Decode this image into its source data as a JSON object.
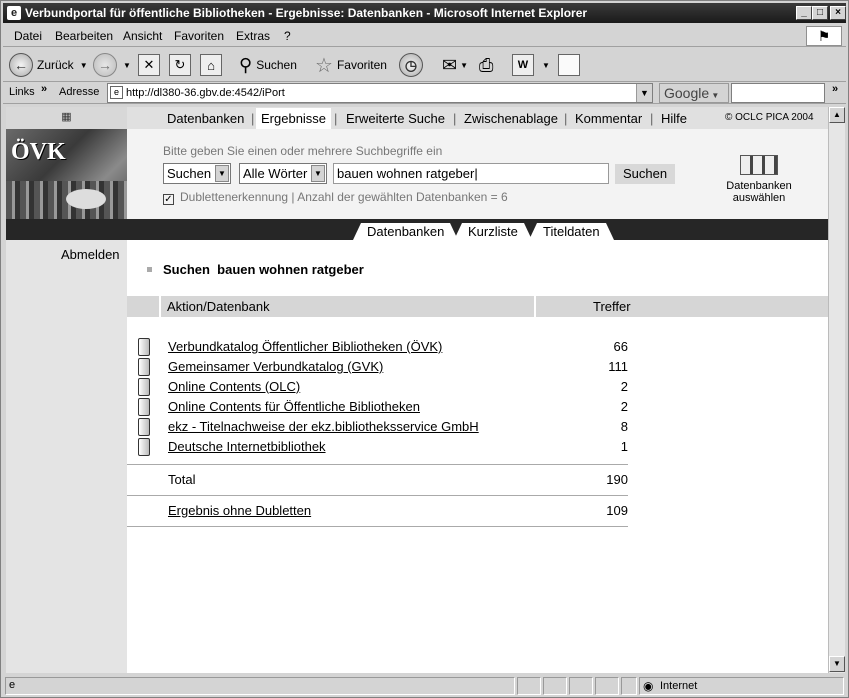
{
  "window": {
    "title": "Verbundportal für öffentliche Bibliotheken - Ergebnisse: Datenbanken - Microsoft Internet Explorer",
    "controls": {
      "min": "_",
      "max": "□",
      "close": "×"
    }
  },
  "menu": {
    "items": [
      "Datei",
      "Bearbeiten",
      "Ansicht",
      "Favoriten",
      "Extras",
      "?"
    ]
  },
  "toolbar": {
    "back": "Zurück",
    "search": "Suchen",
    "favorites": "Favoriten"
  },
  "addressbar": {
    "links": "Links",
    "label": "Adresse",
    "url": "http://dl380-36.gbv.de:4542/iPort",
    "google": "Google"
  },
  "portal": {
    "flag_icon": "uk-flag-icon",
    "logo_text": "ÖVK",
    "nav": [
      "Datenbanken",
      "Ergebnisse",
      "Erweiterte Suche",
      "Zwischenablage",
      "Kommentar",
      "Hilfe"
    ],
    "active_nav": "Ergebnisse",
    "copyright": "© OCLC PICA 2004",
    "search": {
      "hint": "Bitte geben Sie einen oder mehrere Suchbegriffe ein",
      "mode": "Suchen",
      "words": "Alle Wörter",
      "query": "bauen wohnen ratgeber",
      "button": "Suchen",
      "dedup": "Dublettenerkennung | Anzahl der gewählten Datenbanken = 6",
      "dedup_checked": "✓"
    },
    "db_select": {
      "line1": "Datenbanken",
      "line2": "auswählen"
    },
    "tabs": [
      "Datenbanken",
      "Kurzliste",
      "Titeldaten"
    ],
    "logout": "Abmelden",
    "result_heading": "Suchen  bauen wohnen ratgeber",
    "table": {
      "col_action": "Aktion/Datenbank",
      "col_hits": "Treffer",
      "rows": [
        {
          "name": "Verbundkatalog Öffentlicher Bibliotheken (ÖVK)",
          "hits": "66"
        },
        {
          "name": "Gemeinsamer Verbundkatalog (GVK)",
          "hits": "111"
        },
        {
          "name": "Online Contents (OLC)",
          "hits": "2"
        },
        {
          "name": "Online Contents für Öffentliche Bibliotheken",
          "hits": "2"
        },
        {
          "name": "ekz - Titelnachweise der ekz.bibliotheksservice GmbH",
          "hits": "8"
        },
        {
          "name": "Deutsche Internetbibliothek",
          "hits": "1"
        }
      ],
      "total_label": "Total",
      "total": "190",
      "dedup_label": "Ergebnis ohne Dubletten",
      "dedup_total": "109"
    }
  },
  "status": {
    "zone": "Internet"
  }
}
